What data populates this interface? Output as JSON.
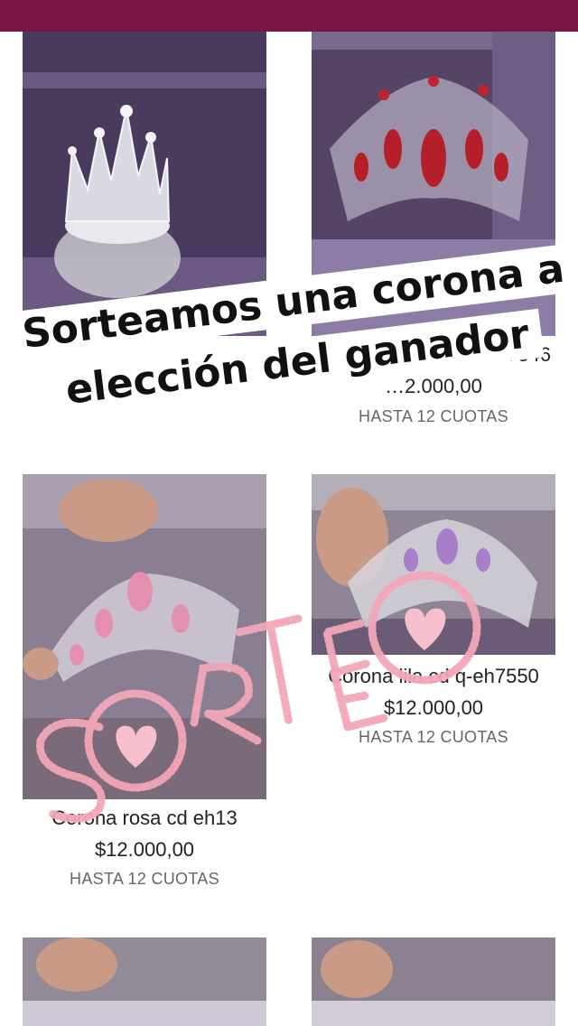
{
  "colors": {
    "topbar": "#7a1446",
    "sorteo_accent": "#f2a7b8"
  },
  "products": [
    {
      "name": "",
      "price": "",
      "installments": ""
    },
    {
      "name": "7546",
      "price": "…2.000,00",
      "installments": "HASTA 12 CUOTAS"
    },
    {
      "name": "Corona rosa cd eh13",
      "price": "$12.000,00",
      "installments": "HASTA 12 CUOTAS"
    },
    {
      "name": "Corona lila cd q-eh7550",
      "price": "$12.000,00",
      "installments": "HASTA 12 CUOTAS"
    }
  ],
  "overlay": {
    "banner_line1": "Sorteamos una corona a",
    "banner_line2": "elección del ganador",
    "stamp": "SORTEO"
  },
  "icons": [
    "heart-icon"
  ]
}
